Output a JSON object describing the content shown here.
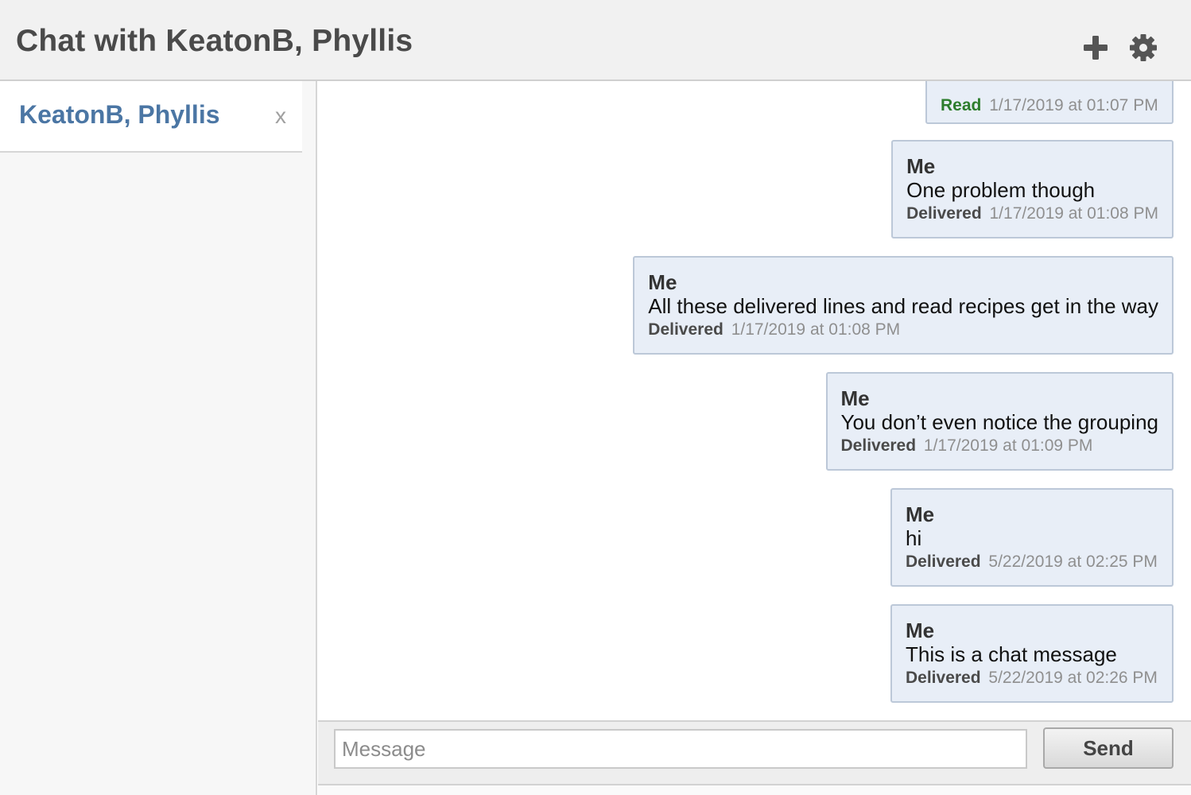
{
  "header": {
    "title": "Chat with KeatonB, Phyllis",
    "icons": [
      "plus-icon",
      "gear-icon"
    ]
  },
  "sidebar": {
    "conversations": [
      {
        "name": "KeatonB, Phyllis",
        "close_label": "x"
      }
    ]
  },
  "messages": [
    {
      "sender": "",
      "text": "",
      "status": "Read",
      "time": "1/17/2019 at 01:07 PM"
    },
    {
      "sender": "Me",
      "text": "One problem though",
      "status": "Delivered",
      "time": "1/17/2019 at 01:08 PM"
    },
    {
      "sender": "Me",
      "text": "All these delivered lines and read recipes get in the way",
      "status": "Delivered",
      "time": "1/17/2019 at 01:08 PM"
    },
    {
      "sender": "Me",
      "text": "You don’t even notice the grouping",
      "status": "Delivered",
      "time": "1/17/2019 at 01:09 PM"
    },
    {
      "sender": "Me",
      "text": "hi",
      "status": "Delivered",
      "time": "5/22/2019 at 02:25 PM"
    },
    {
      "sender": "Me",
      "text": "This is a chat message",
      "status": "Delivered",
      "time": "5/22/2019 at 02:26 PM"
    }
  ],
  "composer": {
    "placeholder": "Message",
    "value": "",
    "send_label": "Send"
  },
  "colors": {
    "accent": "#4b76a4",
    "read_status": "#2d7d2d",
    "bubble_bg": "#e8eef7"
  }
}
